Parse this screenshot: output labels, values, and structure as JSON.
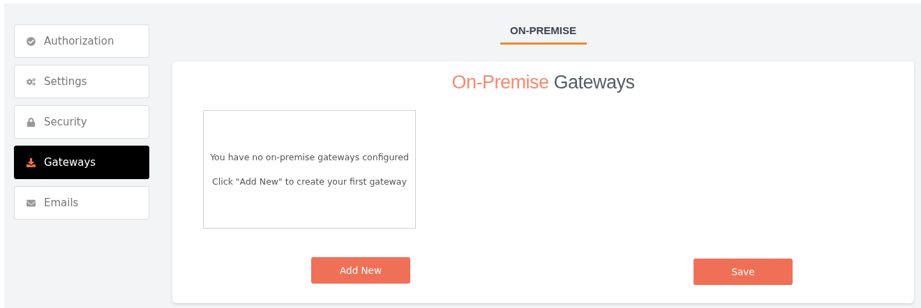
{
  "sidebar": {
    "items": [
      {
        "label": "Authorization",
        "selected": false
      },
      {
        "label": "Settings",
        "selected": false
      },
      {
        "label": "Security",
        "selected": false
      },
      {
        "label": "Gateways",
        "selected": true
      },
      {
        "label": "Emails",
        "selected": false
      }
    ]
  },
  "tabs": [
    {
      "label": "ON-PREMISE",
      "selected": true
    }
  ],
  "card": {
    "title": {
      "accent": "On-Premise",
      "rest": "Gateways"
    },
    "empty_state": [
      "You have no on-premise gateways configured",
      "Click \"Add New\" to create your first gateway"
    ],
    "buttons": [
      "Add New",
      "Save"
    ]
  }
}
